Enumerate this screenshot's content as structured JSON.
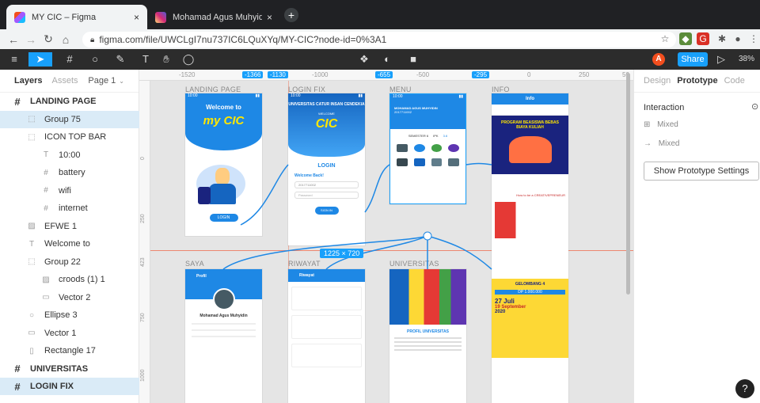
{
  "browser": {
    "tabs": [
      {
        "title": "MY CIC – Figma",
        "close": "×",
        "active": true
      },
      {
        "title": "Mohamad Agus Muhyidin (@mu",
        "close": "×",
        "active": false
      }
    ],
    "new_tab": "+",
    "url": "figma.com/file/UWCLgI7nu737IC6LQuXYq/MY-CIC?node-id=0%3A1"
  },
  "figma_toolbar": {
    "avatar_letter": "A",
    "share_label": "Share",
    "zoom": "38%"
  },
  "layers_panel": {
    "tab_layers": "Layers",
    "tab_assets": "Assets",
    "page_selector": "Page 1",
    "items": [
      {
        "label": "LANDING PAGE",
        "type": "frame",
        "indent": 0,
        "selected": false
      },
      {
        "label": "Group 75",
        "type": "group",
        "indent": 1,
        "selected": true
      },
      {
        "label": "ICON TOP BAR",
        "type": "group",
        "indent": 1,
        "selected": false
      },
      {
        "label": "10:00",
        "type": "text",
        "indent": 2,
        "selected": false
      },
      {
        "label": "battery",
        "type": "frame-small",
        "indent": 2,
        "selected": false
      },
      {
        "label": "wifi",
        "type": "frame-small",
        "indent": 2,
        "selected": false
      },
      {
        "label": "internet",
        "type": "frame-small",
        "indent": 2,
        "selected": false
      },
      {
        "label": "EFWE 1",
        "type": "image",
        "indent": 1,
        "selected": false
      },
      {
        "label": "Welcome to",
        "type": "text",
        "indent": 1,
        "selected": false
      },
      {
        "label": "Group 22",
        "type": "group",
        "indent": 1,
        "selected": false
      },
      {
        "label": "croods (1) 1",
        "type": "image",
        "indent": 2,
        "selected": false
      },
      {
        "label": "Vector 2",
        "type": "vector",
        "indent": 2,
        "selected": false
      },
      {
        "label": "Ellipse 3",
        "type": "ellipse",
        "indent": 1,
        "selected": false
      },
      {
        "label": "Vector 1",
        "type": "vector",
        "indent": 1,
        "selected": false
      },
      {
        "label": "Rectangle 17",
        "type": "rect",
        "indent": 1,
        "selected": false
      },
      {
        "label": "UNIVERSITAS",
        "type": "frame",
        "indent": 0,
        "selected": false
      },
      {
        "label": "LOGIN FIX",
        "type": "frame",
        "indent": 0,
        "selected": true
      }
    ]
  },
  "canvas": {
    "ruler_ticks": [
      "-1520",
      "-1366",
      "-1130",
      "-1000",
      "-655",
      "-500",
      "-295",
      "0",
      "250",
      "50"
    ],
    "ruler_left_ticks": [
      "0",
      "250",
      "423",
      "750",
      "1000"
    ],
    "frames": [
      {
        "label": "LANDING PAGE"
      },
      {
        "label": "LOGIN FIX"
      },
      {
        "label": "MENU"
      },
      {
        "label": "INFO"
      },
      {
        "label": "SAYA"
      },
      {
        "label": "RIWAYAT"
      },
      {
        "label": "UNIVERSITAS"
      }
    ],
    "size_badge": "1225 × 720",
    "landing": {
      "welcome": "Welcome to",
      "logo": "my CIC",
      "button": "LOGIN"
    },
    "login": {
      "header": "UNIVERSITAS CATUR INSAN CENDEKIA",
      "welcome": "WELCOME",
      "logo": "CIC",
      "title": "LOGIN",
      "subtitle": "Welcome Back!",
      "user": "2017711002",
      "password": "Password",
      "button": "SIGN IN"
    },
    "menu": {
      "name": "MOHAMAD AGUS MUHYIDIN",
      "nim": "2017711002",
      "semester": "SEMESTER 6",
      "ipk": "IPK",
      "ipk_val": "3.6"
    },
    "info": {
      "header": "Info",
      "program": "PROGRAM BEASISWA BEBAS BIAYA KULIAH",
      "creative": "How to be a CREATIVEPRENEUR",
      "gelombang": "GELOMBANG 4",
      "price": "DP 1.000.000",
      "date1": "27 Juli",
      "date2": "19 September",
      "year": "2020"
    },
    "saya": {
      "header": "Profil",
      "name": "Mohamad Agus Muhyidin"
    },
    "riwayat": {
      "header": "Riwayat"
    },
    "universitas": {
      "title": "PROFIL UNIVERSITAS"
    }
  },
  "right_panel": {
    "tabs": [
      "Design",
      "Prototype",
      "Code"
    ],
    "active_tab": "Prototype",
    "interaction_label": "Interaction",
    "mixed1": "Mixed",
    "mixed2": "Mixed",
    "settings_button": "Show Prototype Settings"
  },
  "help": "?",
  "colors": {
    "figma_blue": "#18a0fb",
    "app_blue": "#1e88e5",
    "selection": "#daebf7",
    "flow_arrow": "#1e88e5",
    "guide_red": "#f24822"
  }
}
